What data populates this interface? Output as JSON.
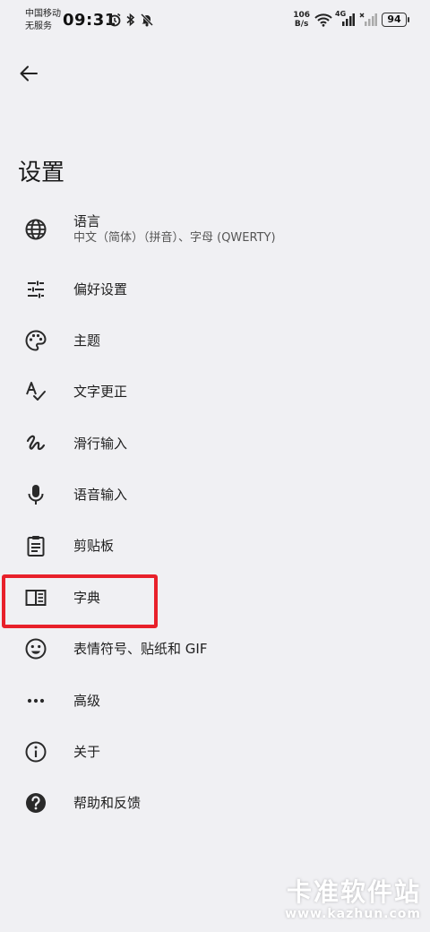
{
  "status_bar": {
    "carrier_line1": "中国移动",
    "carrier_line2": "无服务",
    "time": "09:31",
    "net_speed_value": "106",
    "net_speed_unit": "B/s",
    "network_type": "4G",
    "battery": "94"
  },
  "header": {
    "title": "设置"
  },
  "settings": {
    "items": [
      {
        "label": "语言",
        "sublabel": "中文（简体）（拼音）、字母 (QWERTY)",
        "icon": "globe-icon"
      },
      {
        "label": "偏好设置",
        "icon": "sliders-icon"
      },
      {
        "label": "主题",
        "icon": "palette-icon"
      },
      {
        "label": "文字更正",
        "icon": "spellcheck-icon"
      },
      {
        "label": "滑行输入",
        "icon": "gesture-icon"
      },
      {
        "label": "语音输入",
        "icon": "microphone-icon"
      },
      {
        "label": "剪贴板",
        "icon": "clipboard-icon"
      },
      {
        "label": "字典",
        "icon": "dictionary-icon"
      },
      {
        "label": "表情符号、贴纸和 GIF",
        "icon": "emoji-icon"
      },
      {
        "label": "高级",
        "icon": "more-dots-icon"
      },
      {
        "label": "关于",
        "icon": "info-icon"
      },
      {
        "label": "帮助和反馈",
        "icon": "help-icon"
      }
    ]
  },
  "annotation": {
    "highlight_color": "#e8202a"
  },
  "watermark": {
    "title": "卡准软件站",
    "url": "www.kazhun.com"
  }
}
